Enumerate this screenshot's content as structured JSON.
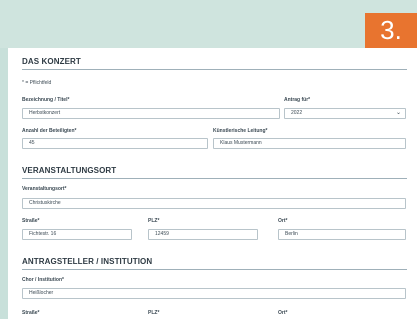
{
  "step": "3.",
  "sections": {
    "konzert": {
      "title": "DAS KONZERT",
      "required_note": "* = Pflichtfeld",
      "bezeichnung": {
        "label": "Bezeichnung / Titel*",
        "value": "Herbstkonzert"
      },
      "antrag": {
        "label": "Antrag für*",
        "value": "2022"
      },
      "anzahl": {
        "label": "Anzahl der Beteiligten*",
        "value": "45"
      },
      "leitung": {
        "label": "Künstlerische Leitung*",
        "value": "Klaus Mustermann"
      }
    },
    "ort": {
      "title": "VERANSTALTUNGSORT",
      "veranstaltungsort": {
        "label": "Veranstaltungsort*",
        "value": "Christuskirche"
      },
      "strasse": {
        "label": "Straße*",
        "value": "Fichtestr. 16"
      },
      "plz": {
        "label": "PLZ*",
        "value": "12459"
      },
      "ort": {
        "label": "Ort*",
        "value": "Berlin"
      }
    },
    "antragsteller": {
      "title": "ANTRAGSTELLER / INSTITUTION",
      "chor": {
        "label": "Chor / Institution*",
        "value": "Heißlocher"
      },
      "strasse": {
        "label": "Straße*"
      },
      "plz": {
        "label": "PLZ*"
      },
      "ort": {
        "label": "Ort*"
      }
    }
  }
}
